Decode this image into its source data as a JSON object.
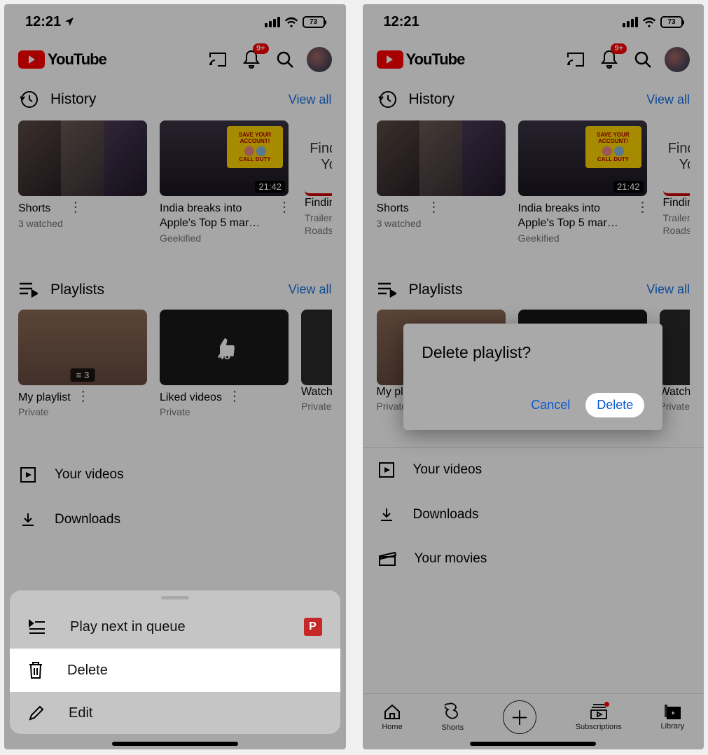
{
  "status": {
    "time": "12:21",
    "battery": "73"
  },
  "app": {
    "name": "YouTube",
    "notif_badge": "9+"
  },
  "history": {
    "heading": "History",
    "viewall": "View all",
    "items": [
      {
        "title": "Shorts",
        "sub": "3 watched"
      },
      {
        "title": "India breaks into Apple's Top 5 mar…",
        "sub": "Geekified",
        "duration": "21:42",
        "banner1": "SAVE YOUR",
        "banner2": "ACCOUNT!",
        "banner3": "CALL DUTY"
      },
      {
        "title_left": "Finding",
        "title_right": "Finding Y",
        "sub_left": "Trailer | I",
        "sub_right": "Trailer | I",
        "ch": "Roadside",
        "script1": "Finding",
        "script2": "You"
      }
    ]
  },
  "playlists": {
    "heading": "Playlists",
    "viewall": "View all",
    "items": [
      {
        "title": "My playlist",
        "sub": "Private",
        "count": "3",
        "short_left": "My pl"
      },
      {
        "title": "Liked videos",
        "sub": "Private",
        "likes": "48"
      },
      {
        "title": "Watch L",
        "title_right": "Watch la",
        "sub": "Private"
      }
    ]
  },
  "links": {
    "yourvideos": "Your videos",
    "downloads": "Downloads",
    "yourmovies": "Your movies"
  },
  "sheet": {
    "play_next": "Play next in queue",
    "delete": "Delete",
    "edit": "Edit",
    "p": "P"
  },
  "dialog": {
    "title": "Delete playlist?",
    "cancel": "Cancel",
    "delete": "Delete"
  },
  "tabs": {
    "home": "Home",
    "shorts": "Shorts",
    "subs": "Subscriptions",
    "library": "Library"
  }
}
